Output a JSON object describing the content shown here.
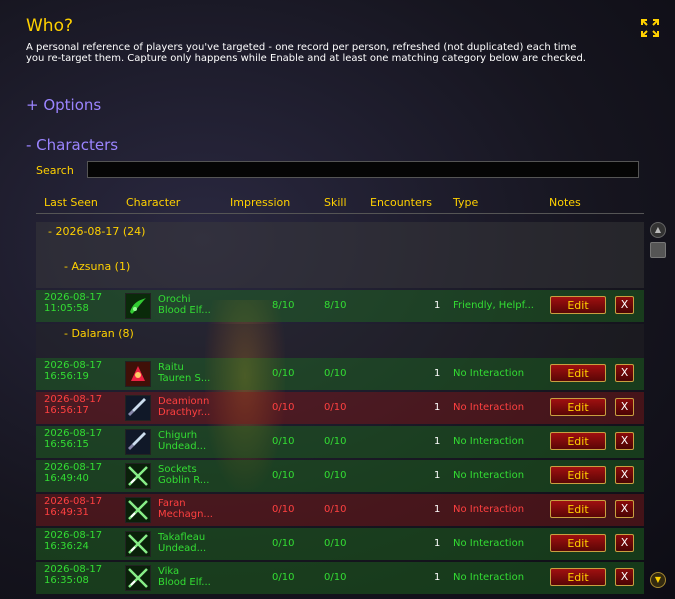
{
  "title": "Who?",
  "description": "A personal reference of players you've targeted - one record per person, refreshed (not duplicated) each time you re-target them. Capture only happens while Enable and at least one matching category below are checked.",
  "sections": {
    "options": "+ Options",
    "characters": "- Characters"
  },
  "search": {
    "label": "Search",
    "value": ""
  },
  "columns": [
    "Last Seen",
    "Character",
    "Impression",
    "Skill",
    "Encounters",
    "Type",
    "Notes"
  ],
  "buttons": {
    "edit": "Edit",
    "delete": "X"
  },
  "colors": {
    "friendly": "#33dd33",
    "hostile": "#ff4040",
    "header": "#ffd100",
    "section": "#9b84ff"
  },
  "date_group": "-   2026-08-17 (24)",
  "zones": [
    "-   Azsuna (1)",
    "-   Dalaran (8)"
  ],
  "rows": [
    {
      "date": "2026-08-17",
      "time": "11:05:58",
      "name": "Orochi",
      "race": "Blood Elf...",
      "impression": "8/10",
      "skill": "8/10",
      "encounters": "1",
      "type": "Friendly, Helpf...",
      "status": "green",
      "icon": "green-swirl-icon"
    },
    {
      "date": "2026-08-17",
      "time": "16:56:19",
      "name": "Raitu",
      "race": "Tauren S...",
      "impression": "0/10",
      "skill": "0/10",
      "encounters": "1",
      "type": "No Interaction",
      "status": "green",
      "icon": "red-fist-icon"
    },
    {
      "date": "2026-08-17",
      "time": "16:56:17",
      "name": "Deamionn",
      "race": "Dracthyr...",
      "impression": "0/10",
      "skill": "0/10",
      "encounters": "1",
      "type": "No Interaction",
      "status": "red",
      "icon": "sword-icon"
    },
    {
      "date": "2026-08-17",
      "time": "16:56:15",
      "name": "Chigurh",
      "race": "Undead...",
      "impression": "0/10",
      "skill": "0/10",
      "encounters": "1",
      "type": "No Interaction",
      "status": "green",
      "icon": "sword-icon"
    },
    {
      "date": "2026-08-17",
      "time": "16:49:40",
      "name": "Sockets",
      "race": "Goblin R...",
      "impression": "0/10",
      "skill": "0/10",
      "encounters": "1",
      "type": "No Interaction",
      "status": "green",
      "icon": "crossed-daggers-icon"
    },
    {
      "date": "2026-08-17",
      "time": "16:49:31",
      "name": "Faran",
      "race": "Mechagn...",
      "impression": "0/10",
      "skill": "0/10",
      "encounters": "1",
      "type": "No Interaction",
      "status": "red",
      "icon": "crossed-daggers-icon"
    },
    {
      "date": "2026-08-17",
      "time": "16:36:24",
      "name": "Takafleau",
      "race": "Undead...",
      "impression": "0/10",
      "skill": "0/10",
      "encounters": "1",
      "type": "No Interaction",
      "status": "green",
      "icon": "crossed-daggers-icon"
    },
    {
      "date": "2026-08-17",
      "time": "16:35:08",
      "name": "Vika",
      "race": "Blood Elf...",
      "impression": "0/10",
      "skill": "0/10",
      "encounters": "1",
      "type": "No Interaction",
      "status": "green",
      "icon": "crossed-daggers-icon"
    }
  ]
}
